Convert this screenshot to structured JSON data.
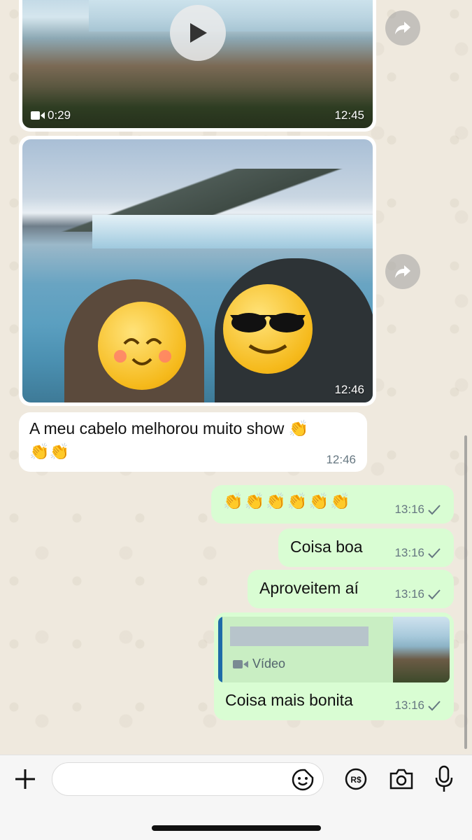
{
  "messages": {
    "video": {
      "duration": "0:29",
      "time": "12:45"
    },
    "photo": {
      "time": "12:46"
    },
    "incoming_text": {
      "text": "A meu cabelo melhorou muito show 👏",
      "text2": "👏👏",
      "time": "12:46"
    },
    "outgoing": [
      {
        "text": "👏👏👏👏👏👏",
        "time": "13:16"
      },
      {
        "text": "Coisa boa",
        "time": "13:16"
      },
      {
        "text": "Aproveitem aí",
        "time": "13:16"
      }
    ],
    "reply": {
      "quoted_type": "Vídeo",
      "text": "Coisa mais bonita",
      "time": "13:16"
    }
  },
  "colors": {
    "incoming_bubble": "#ffffff",
    "outgoing_bubble": "#d9fdd3",
    "quote_accent": "#1e6ba8",
    "chat_background": "#efeae2"
  },
  "icons": {
    "play": "play-icon",
    "forward": "forward-icon",
    "video": "video-camera-icon",
    "check": "check-icon",
    "attach": "plus-icon",
    "sticker": "sticker-icon",
    "payment": "payment-icon",
    "camera": "camera-icon",
    "mic": "microphone-icon"
  }
}
